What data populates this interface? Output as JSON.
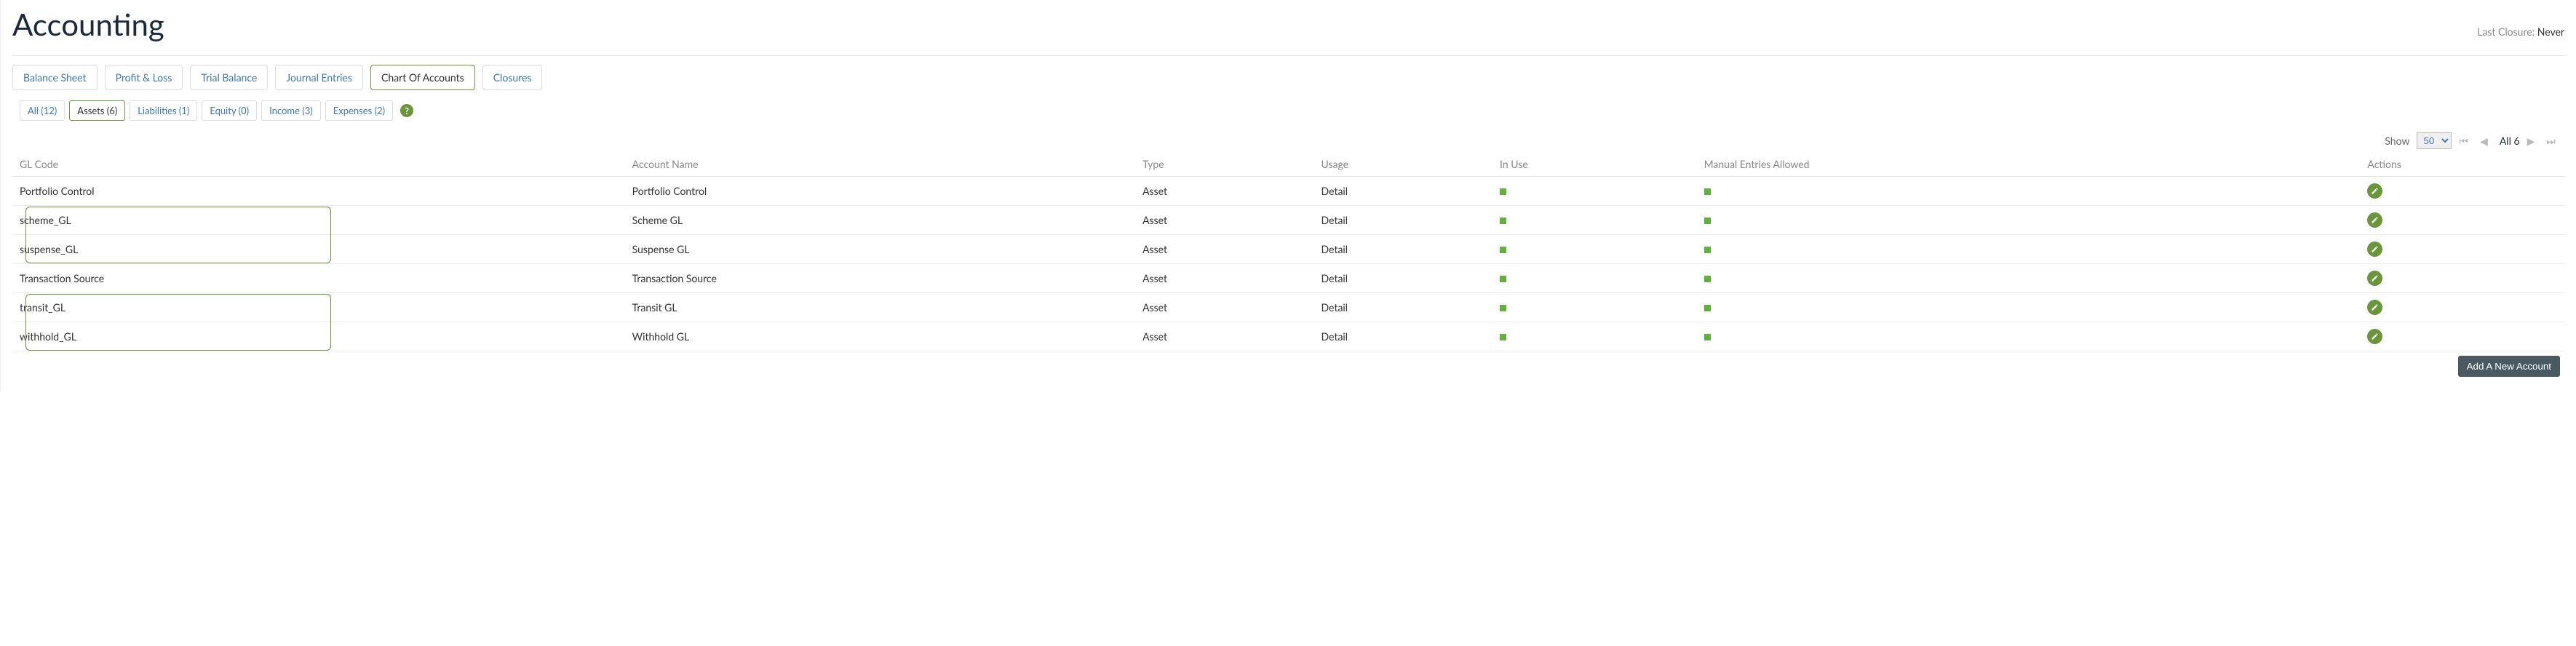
{
  "header": {
    "title": "Accounting",
    "lastClosureLabel": "Last Closure:",
    "lastClosureValue": "Never"
  },
  "tabs": [
    {
      "label": "Balance Sheet",
      "active": false
    },
    {
      "label": "Profit & Loss",
      "active": false
    },
    {
      "label": "Trial Balance",
      "active": false
    },
    {
      "label": "Journal Entries",
      "active": false
    },
    {
      "label": "Chart Of Accounts",
      "active": true
    },
    {
      "label": "Closures",
      "active": false
    }
  ],
  "filters": [
    {
      "label": "All (12)",
      "active": false
    },
    {
      "label": "Assets (6)",
      "active": true
    },
    {
      "label": "Liabilities (1)",
      "active": false
    },
    {
      "label": "Equity (0)",
      "active": false
    },
    {
      "label": "Income (3)",
      "active": false
    },
    {
      "label": "Expenses (2)",
      "active": false
    }
  ],
  "pager": {
    "showLabel": "Show",
    "pageSize": "50",
    "centerText": "All 6"
  },
  "columns": {
    "gl": "GL Code",
    "name": "Account Name",
    "type": "Type",
    "usage": "Usage",
    "inuse": "In Use",
    "manual": "Manual Entries Allowed",
    "actions": "Actions"
  },
  "rows": [
    {
      "gl": "Portfolio Control",
      "name": "Portfolio Control",
      "type": "Asset",
      "usage": "Detail",
      "inuse": true,
      "manual": true,
      "highlightGroup": null
    },
    {
      "gl": "scheme_GL",
      "name": "Scheme GL",
      "type": "Asset",
      "usage": "Detail",
      "inuse": true,
      "manual": true,
      "highlightGroup": 1
    },
    {
      "gl": "suspense_GL",
      "name": "Suspense GL",
      "type": "Asset",
      "usage": "Detail",
      "inuse": true,
      "manual": true,
      "highlightGroup": 1
    },
    {
      "gl": "Transaction Source",
      "name": "Transaction Source",
      "type": "Asset",
      "usage": "Detail",
      "inuse": true,
      "manual": true,
      "highlightGroup": null
    },
    {
      "gl": "transit_GL",
      "name": "Transit GL",
      "type": "Asset",
      "usage": "Detail",
      "inuse": true,
      "manual": true,
      "highlightGroup": 2
    },
    {
      "gl": "withhold_GL",
      "name": "Withhold GL",
      "type": "Asset",
      "usage": "Detail",
      "inuse": true,
      "manual": true,
      "highlightGroup": 2
    }
  ],
  "addButton": "Add A New Account"
}
